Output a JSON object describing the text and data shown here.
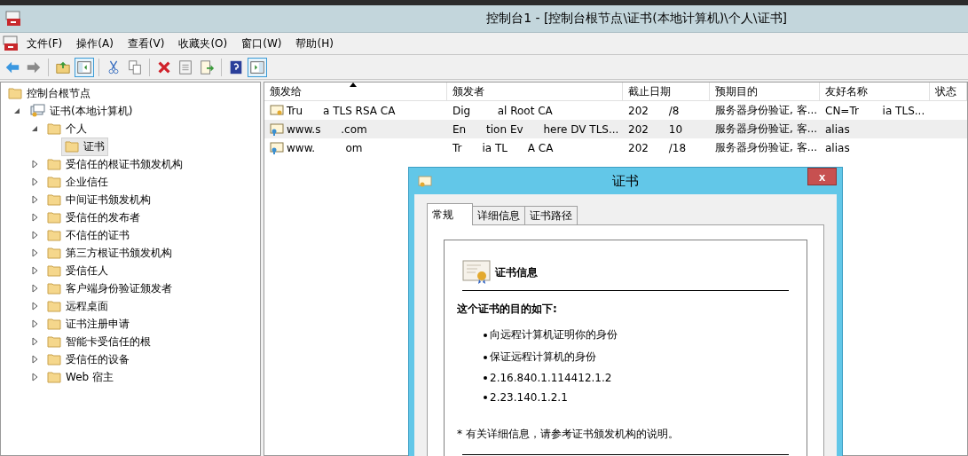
{
  "window": {
    "title": "控制台1 - [控制台根节点\\证书(本地计算机)\\个人\\证书]"
  },
  "menu": [
    "文件(F)",
    "操作(A)",
    "查看(V)",
    "收藏夹(O)",
    "窗口(W)",
    "帮助(H)"
  ],
  "toolbar": [
    [
      {
        "kind": "back",
        "selected": false
      },
      {
        "kind": "forward",
        "selected": false
      }
    ],
    [
      {
        "kind": "up",
        "selected": false
      },
      {
        "kind": "tree",
        "selected": true
      }
    ],
    [
      {
        "kind": "cut",
        "selected": false
      },
      {
        "kind": "copy",
        "selected": false
      }
    ],
    [
      {
        "kind": "delete",
        "selected": false
      },
      {
        "kind": "props",
        "selected": false
      },
      {
        "kind": "export",
        "selected": false
      }
    ],
    [
      {
        "kind": "help",
        "selected": false
      },
      {
        "kind": "action",
        "selected": true
      }
    ]
  ],
  "tree": [
    {
      "label": "控制台根节点",
      "kind": "folder",
      "selected": false,
      "children": [
        {
          "label": "证书(本地计算机)",
          "kind": "store",
          "expanded": true,
          "selected": false,
          "children": [
            {
              "label": "个人",
              "kind": "folder",
              "expanded": true,
              "selected": false,
              "children": [
                {
                  "label": "证书",
                  "kind": "folder",
                  "selected": true
                }
              ]
            },
            {
              "label": "受信任的根证书颁发机构",
              "kind": "folder",
              "expanded": false,
              "selected": false
            },
            {
              "label": "企业信任",
              "kind": "folder",
              "expanded": false,
              "selected": false
            },
            {
              "label": "中间证书颁发机构",
              "kind": "folder",
              "expanded": false,
              "selected": false
            },
            {
              "label": "受信任的发布者",
              "kind": "folder",
              "expanded": false,
              "selected": false
            },
            {
              "label": "不信任的证书",
              "kind": "folder",
              "expanded": false,
              "selected": false
            },
            {
              "label": "第三方根证书颁发机构",
              "kind": "folder",
              "expanded": false,
              "selected": false
            },
            {
              "label": "受信任人",
              "kind": "folder",
              "expanded": false,
              "selected": false
            },
            {
              "label": "客户端身份验证颁发者",
              "kind": "folder",
              "expanded": false,
              "selected": false
            },
            {
              "label": "远程桌面",
              "kind": "folder",
              "expanded": false,
              "selected": false
            },
            {
              "label": "证书注册申请",
              "kind": "folder",
              "expanded": false,
              "selected": false
            },
            {
              "label": "智能卡受信任的根",
              "kind": "folder",
              "expanded": false,
              "selected": false
            },
            {
              "label": "受信任的设备",
              "kind": "folder",
              "expanded": false,
              "selected": false
            },
            {
              "label": "Web 宿主",
              "kind": "folder",
              "expanded": false,
              "selected": false
            }
          ]
        }
      ]
    }
  ],
  "table": {
    "columns": [
      "颁发给",
      "颁发者",
      "截止日期",
      "预期目的",
      "友好名称",
      "状态"
    ],
    "rows": [
      {
        "selected": false,
        "key": false,
        "cells": [
          "Tru      a TLS RSA CA",
          "Dig        al Root CA",
          "202      /8",
          "服务器身份验证, 客...",
          "CN=Tr       ia TLS..."
        ]
      },
      {
        "selected": true,
        "key": true,
        "cells": [
          "www.s      .com",
          "En      tion Ev      here DV TLS...",
          "202      10",
          "服务器身份验证, 客...",
          "alias"
        ]
      },
      {
        "selected": false,
        "key": true,
        "cells": [
          "www.         om",
          "Tr      ia TL      A CA",
          "202      /18",
          "服务器身份验证, 客...",
          "alias"
        ]
      }
    ]
  },
  "dialog": {
    "title": "证书",
    "close": "x",
    "tabs": [
      {
        "label": "常规",
        "selected": true
      },
      {
        "label": "详细信息",
        "selected": false
      },
      {
        "label": "证书路径",
        "selected": false
      }
    ],
    "heading": "证书信息",
    "purpose_title": "这个证书的目的如下:",
    "purposes": [
      "向远程计算机证明你的身份",
      "保证远程计算机的身份",
      "2.16.840.1.114412.1.2",
      "2.23.140.1.2.1"
    ],
    "note": "* 有关详细信息，请参考证书颁发机构的说明。"
  }
}
